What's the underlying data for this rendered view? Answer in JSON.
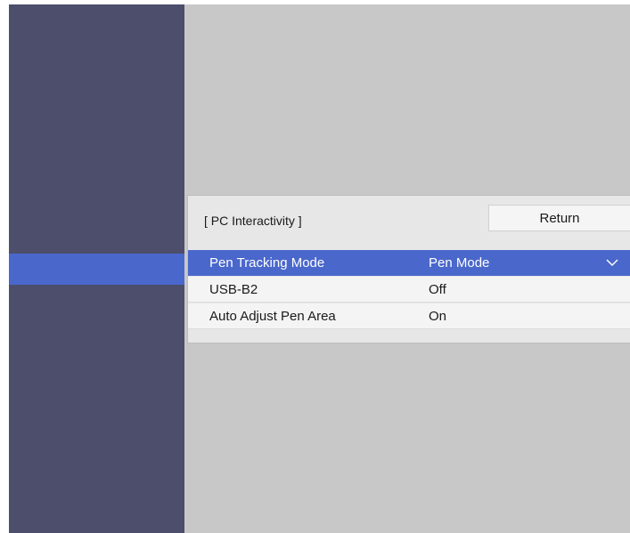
{
  "panel": {
    "title": "[ PC Interactivity ]",
    "return_label": "Return"
  },
  "settings": [
    {
      "label": "Pen Tracking Mode",
      "value": "Pen Mode",
      "selected": true,
      "icon": "chevron-down-icon"
    },
    {
      "label": "USB-B2",
      "value": "Off",
      "selected": false
    },
    {
      "label": "Auto Adjust Pen Area",
      "value": "On",
      "selected": false
    }
  ],
  "colors": {
    "sidebar": "#4c4e6c",
    "highlight": "#4a67cc",
    "background": "#c8c8c8",
    "panel": "#e7e7e7"
  }
}
